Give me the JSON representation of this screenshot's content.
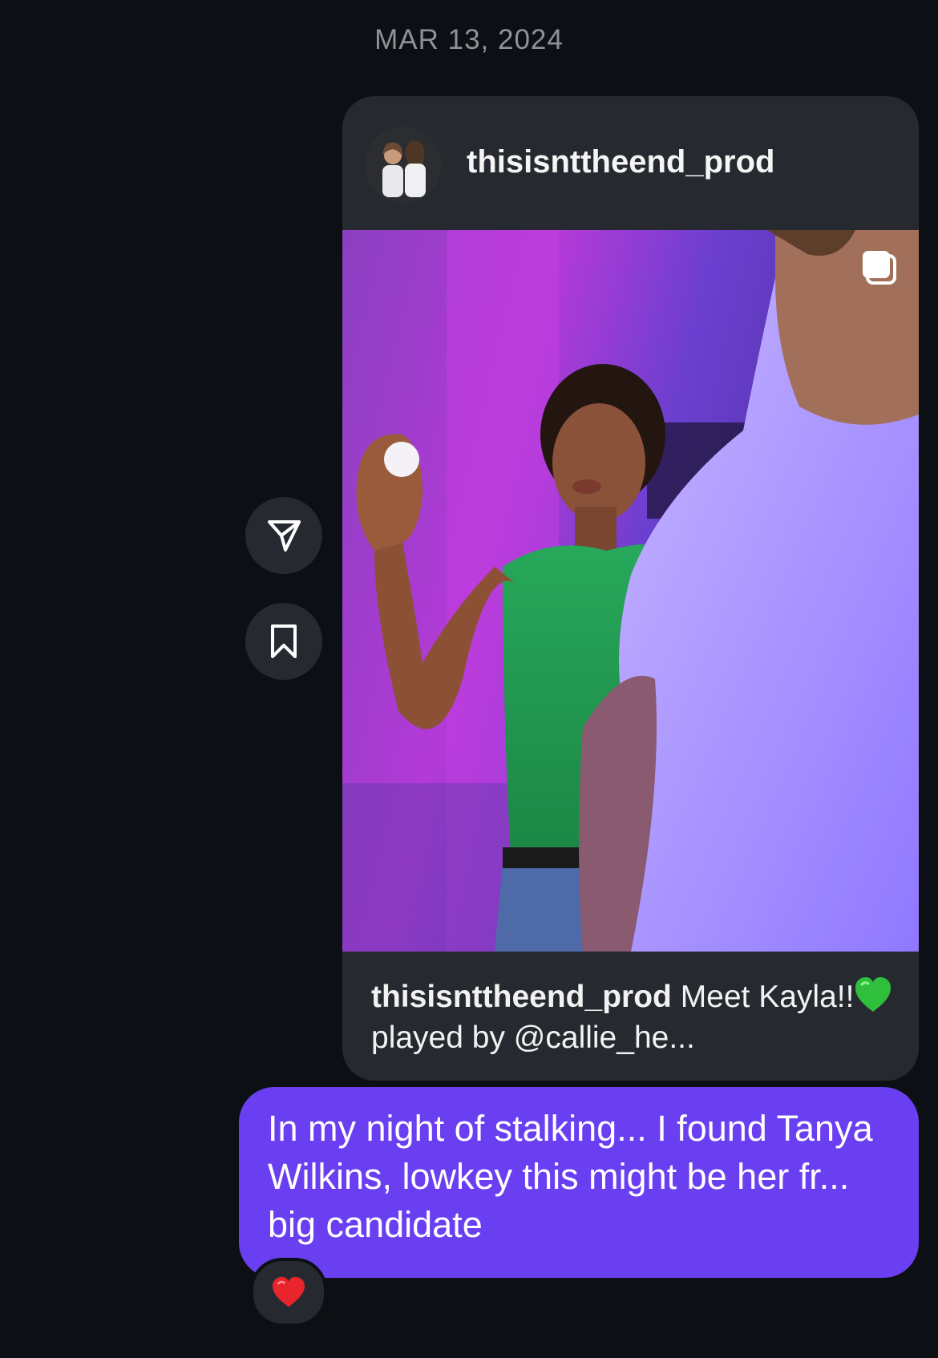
{
  "thread": {
    "date_header": "MAR 13, 2024"
  },
  "shared_post": {
    "username": "thisisnttheend_prod",
    "caption_user": "thisisnttheend_prod",
    "caption_part1": "Meet Kayla!!",
    "caption_emoji": "green-heart",
    "caption_part2": "played by @callie_he...",
    "multi_photo_icon": "carousel-icon",
    "avatar_icon": "profile-avatar"
  },
  "actions": {
    "share_icon": "send-icon",
    "save_icon": "bookmark-icon"
  },
  "message": {
    "text": "In my night of stalking... I found Tanya Wilkins, lowkey this might be her fr... big candidate",
    "reaction": "❤️",
    "bubble_color": "#6a3ff2"
  },
  "colors": {
    "background": "#0c1014",
    "card": "#262a30",
    "muted_text": "#8e9196"
  }
}
